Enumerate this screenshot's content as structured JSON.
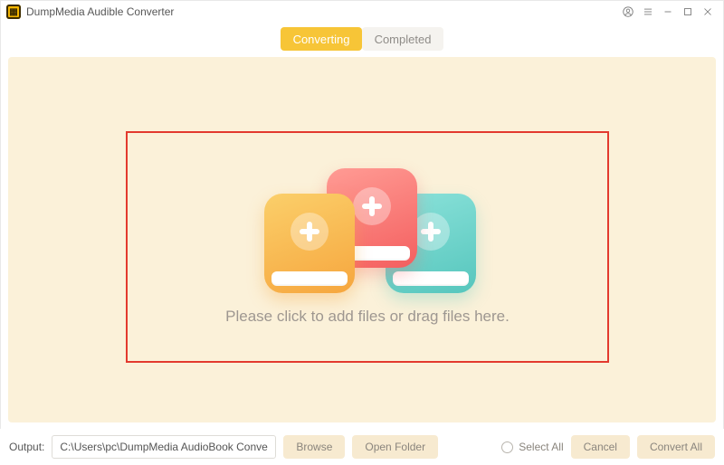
{
  "app": {
    "title": "DumpMedia Audible Converter"
  },
  "tabs": {
    "converting": "Converting",
    "completed": "Completed",
    "active": "converting"
  },
  "dropzone": {
    "hint": "Please click to add files or drag files here."
  },
  "output": {
    "label": "Output:",
    "path": "C:\\Users\\pc\\DumpMedia AudioBook Converte"
  },
  "buttons": {
    "browse": "Browse",
    "open_folder": "Open Folder",
    "select_all": "Select All",
    "cancel": "Cancel",
    "convert_all": "Convert All"
  }
}
